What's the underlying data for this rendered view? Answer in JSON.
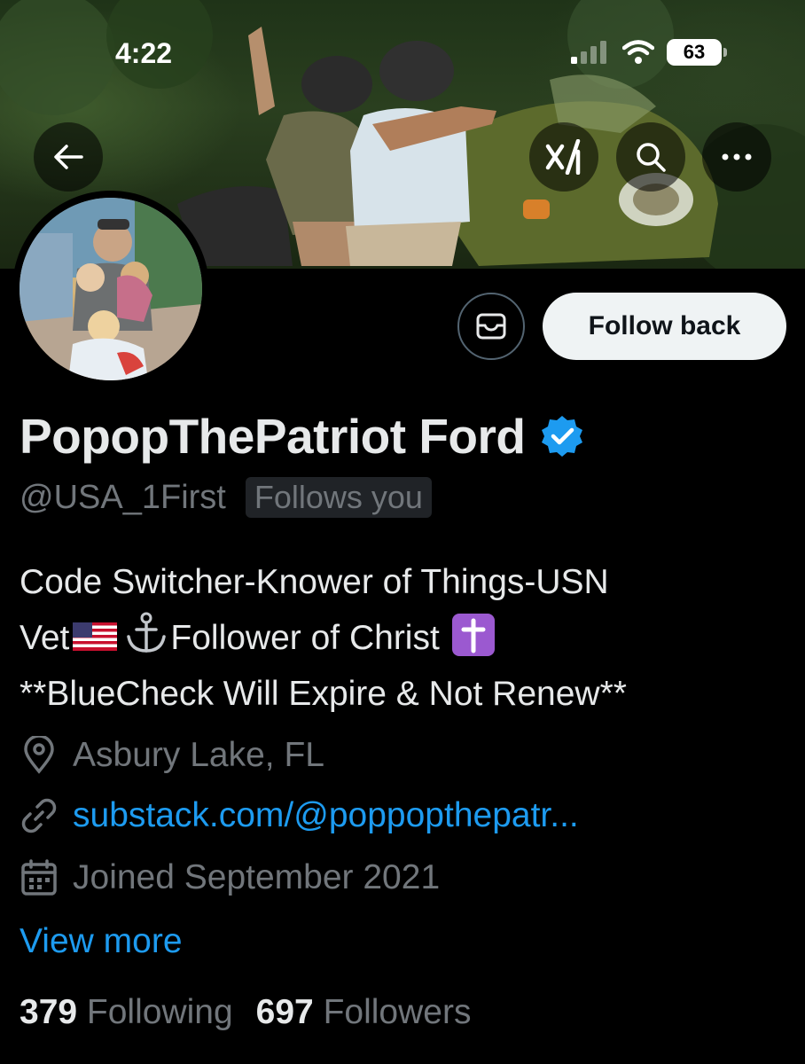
{
  "status_bar": {
    "time": "4:22",
    "battery": "63"
  },
  "header": {
    "back_icon": "arrow-left-icon",
    "grok_icon": "grok-icon",
    "search_icon": "search-icon",
    "more_icon": "more-horizontal-icon"
  },
  "profile": {
    "display_name": "PopopThePatriot Ford",
    "verified": true,
    "handle": "@USA_1First",
    "follows_you": "Follows you",
    "bio_line1": "Code Switcher-Knower of Things-USN",
    "bio_line2_a": "Vet",
    "bio_line2_b": "Follower of Christ",
    "bio_line3": "**BlueCheck Will Expire & Not Renew**",
    "location": "Asbury Lake, FL",
    "website": "substack.com/@poppopthepatr...",
    "joined": "Joined September 2021",
    "view_more": "View more"
  },
  "actions": {
    "follow_back": "Follow back",
    "message_icon": "mail-icon"
  },
  "stats": {
    "following_count": "379",
    "following_label": "Following",
    "followers_count": "697",
    "followers_label": "Followers"
  },
  "colors": {
    "accent": "#1d9bf0",
    "muted": "#71767b",
    "text": "#e7e9ea",
    "background": "#000000"
  }
}
